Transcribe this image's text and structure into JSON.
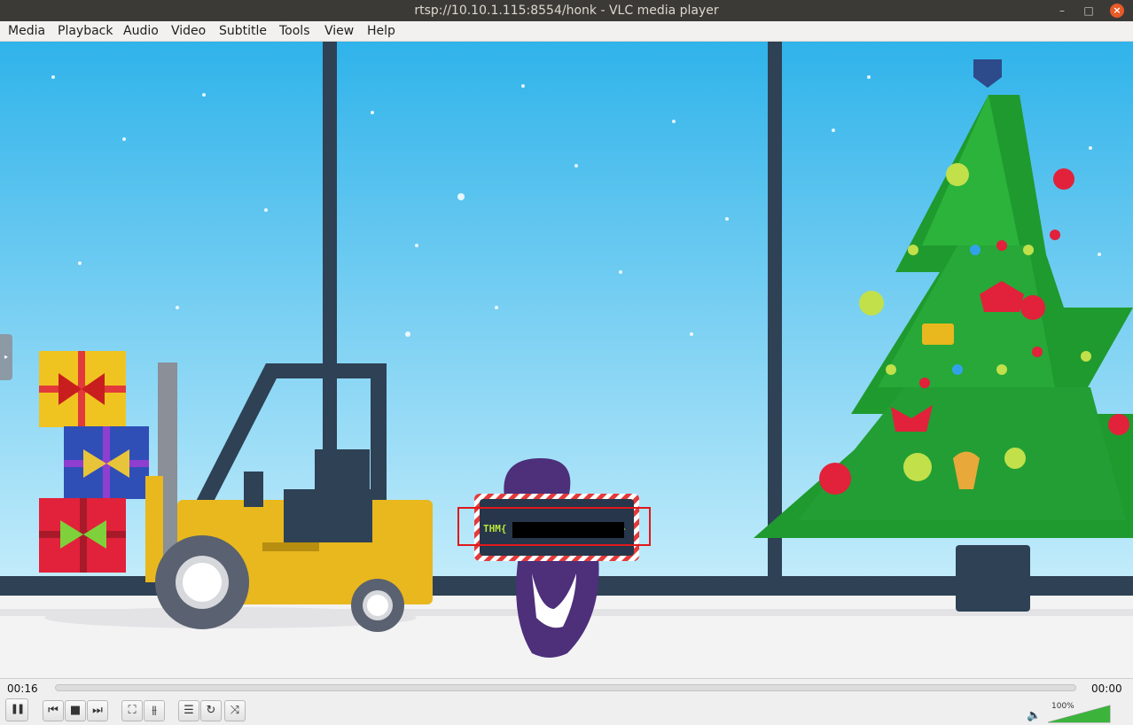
{
  "window": {
    "title": "rtsp://10.10.1.115:8554/honk - VLC media player",
    "min_glyph": "–",
    "max_glyph": "□",
    "close_glyph": "×"
  },
  "menu": [
    {
      "label": "Media"
    },
    {
      "label": "Playback"
    },
    {
      "label": "Audio"
    },
    {
      "label": "Video"
    },
    {
      "label": "Subtitle"
    },
    {
      "label": "Tools"
    },
    {
      "label": "View"
    },
    {
      "label": "Help"
    }
  ],
  "video": {
    "flag_prefix": "THM{",
    "flag_suffix": "}",
    "sidebar_glyph": "▸",
    "progress": 0.0
  },
  "controls": {
    "current_time": "00:16",
    "total_time": "00:00",
    "volume_percent": "100%",
    "volume_level": 1.0,
    "buttons": {
      "pause": "pause-icon",
      "previous": "previous-icon",
      "stop": "stop-icon",
      "next": "next-icon",
      "fullscreen": "fullscreen-icon",
      "extended": "equalizer-icon",
      "playlist": "playlist-icon",
      "loop": "loop-icon",
      "random": "shuffle-icon"
    },
    "glyphs": {
      "pause": "❚❚",
      "previous": "⏮",
      "stop": "■",
      "next": "⏭",
      "fullscreen": "⛶",
      "extended": "⫵",
      "playlist": "☰",
      "loop": "↻",
      "random": "⤨",
      "volume": "🔈"
    }
  },
  "colors": {
    "titlebar": "#3b3a37",
    "close_button": "#e95a26",
    "flag_text": "#b8e63c",
    "highlight_box": "#e0181c",
    "volume_fill": "#3cb43c"
  }
}
